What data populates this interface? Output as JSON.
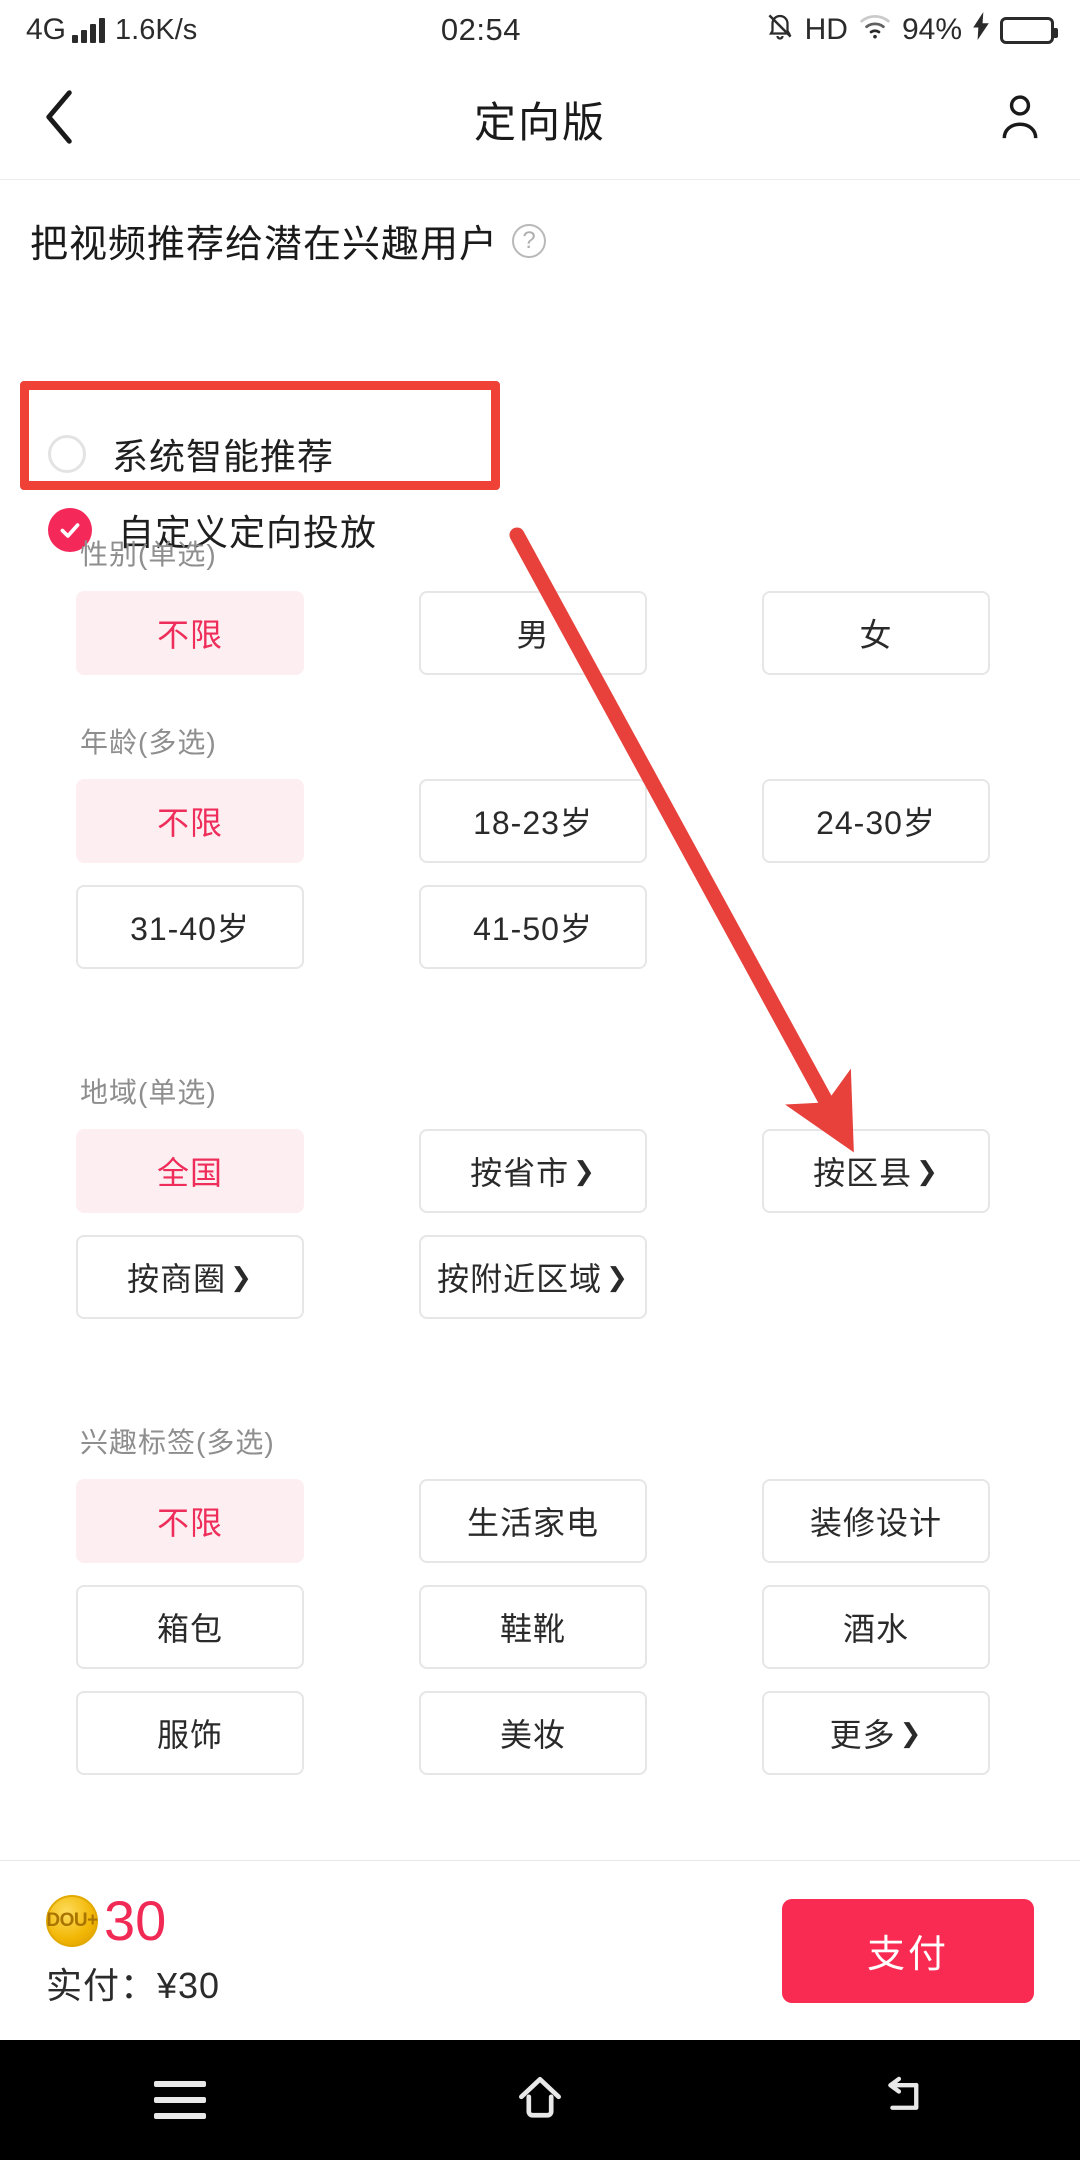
{
  "status_bar": {
    "network_type": "4G",
    "signal_icon": "signal-bars-icon",
    "net_speed": "1.6K/s",
    "time": "02:54",
    "mute_icon": "bell-muted-icon",
    "hd_label": "HD",
    "wifi_icon": "wifi-icon",
    "battery_percent": "94%",
    "charging_icon": "lightning-bolt-icon",
    "battery_icon": "battery-icon"
  },
  "title_bar": {
    "back_icon": "chevron-left-icon",
    "title": "定向版",
    "account_icon": "person-icon"
  },
  "headline": {
    "text": "把视频推荐给潜在兴趣用户",
    "help_icon": "question-mark-icon",
    "help_glyph": "?"
  },
  "mode_options": [
    {
      "label": "系统智能推荐",
      "selected": false
    },
    {
      "label": "自定义定向投放",
      "selected": true
    }
  ],
  "sections": [
    {
      "id": "gender",
      "title": "性别(单选)",
      "chips": [
        {
          "label": "不限",
          "selected": true,
          "chevron": false
        },
        {
          "label": "男",
          "selected": false,
          "chevron": false
        },
        {
          "label": "女",
          "selected": false,
          "chevron": false
        }
      ]
    },
    {
      "id": "age",
      "title": "年龄(多选)",
      "chips": [
        {
          "label": "不限",
          "selected": true,
          "chevron": false
        },
        {
          "label": "18-23岁",
          "selected": false,
          "chevron": false
        },
        {
          "label": "24-30岁",
          "selected": false,
          "chevron": false
        },
        {
          "label": "31-40岁",
          "selected": false,
          "chevron": false
        },
        {
          "label": "41-50岁",
          "selected": false,
          "chevron": false
        }
      ]
    },
    {
      "id": "region",
      "title": "地域(单选)",
      "chips": [
        {
          "label": "全国",
          "selected": true,
          "chevron": false
        },
        {
          "label": "按省市",
          "selected": false,
          "chevron": true
        },
        {
          "label": "按区县",
          "selected": false,
          "chevron": true
        },
        {
          "label": "按商圈",
          "selected": false,
          "chevron": true
        },
        {
          "label": "按附近区域",
          "selected": false,
          "chevron": true
        }
      ]
    },
    {
      "id": "interest",
      "title": "兴趣标签(多选)",
      "chips": [
        {
          "label": "不限",
          "selected": true,
          "chevron": false
        },
        {
          "label": "生活家电",
          "selected": false,
          "chevron": false
        },
        {
          "label": "装修设计",
          "selected": false,
          "chevron": false
        },
        {
          "label": "箱包",
          "selected": false,
          "chevron": false
        },
        {
          "label": "鞋靴",
          "selected": false,
          "chevron": false
        },
        {
          "label": "酒水",
          "selected": false,
          "chevron": false
        },
        {
          "label": "服饰",
          "selected": false,
          "chevron": false
        },
        {
          "label": "美妆",
          "selected": false,
          "chevron": false
        },
        {
          "label": "更多",
          "selected": false,
          "chevron": true
        }
      ]
    }
  ],
  "pay_bar": {
    "coin_icon": "dou-plus-coin-icon",
    "coin_text": "DOU+",
    "coin_amount": "30",
    "actual_pay": "实付：¥30",
    "pay_button": "支付"
  },
  "nav_bar": {
    "recents_icon": "menu-icon",
    "home_icon": "home-icon",
    "back_icon": "back-arrow-icon"
  },
  "annotations": {
    "highlight_color": "#ef4136",
    "arrow_color": "#e8413c",
    "arrow_target": "按区县",
    "highlight_target": "自定义定向投放"
  },
  "colors": {
    "accent": "#fa2b52",
    "selected_chip_bg": "#fdeff1",
    "selected_chip_text": "#ef2d5a",
    "coin_gold": "#f2b705"
  },
  "chevron_glyph": "❯"
}
